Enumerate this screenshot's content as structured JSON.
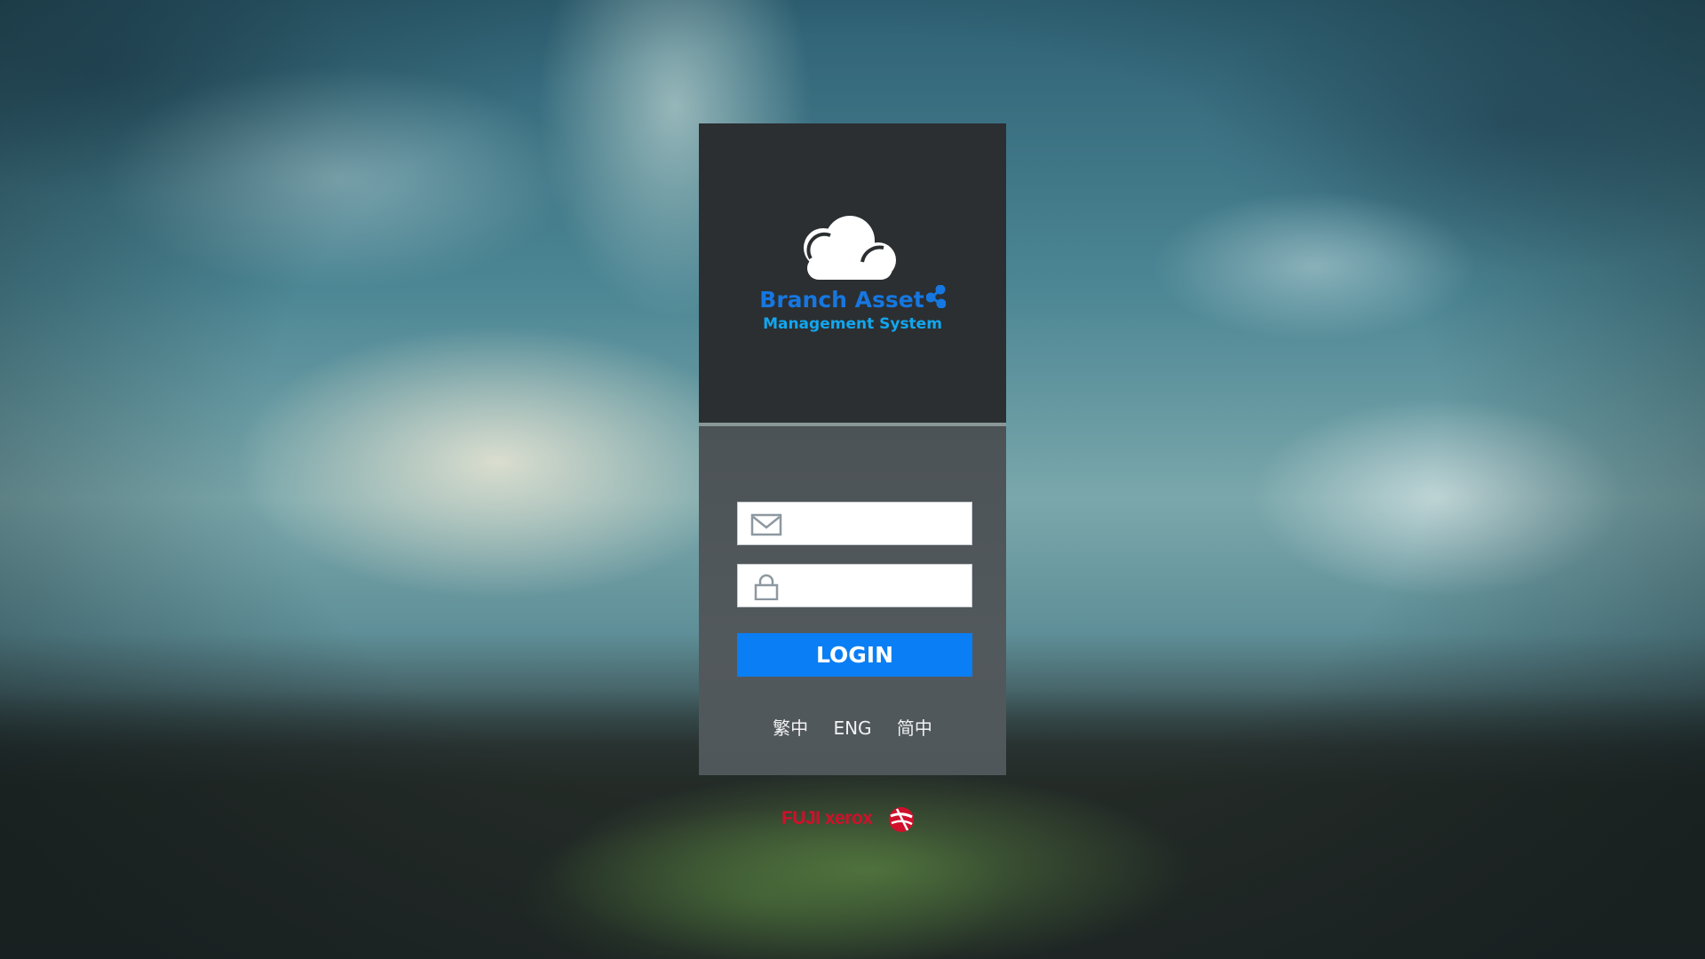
{
  "app": {
    "brand_line1": "Branch Asset",
    "brand_line2": "Management System"
  },
  "login_form": {
    "email_value": "",
    "password_value": "",
    "login_label": "LOGIN"
  },
  "languages": [
    "繁中",
    "ENG",
    "简中"
  ],
  "footer": {
    "company_logo_text": "FUJI xerox"
  },
  "icons": {
    "logo": "cloud-icon",
    "brand_mark": "share-icon",
    "email": "mail-icon",
    "password": "lock-icon",
    "footer_mark": "xerox-ball-icon"
  },
  "colors": {
    "accent": "#0a7ef4",
    "brand_primary": "#1677e0",
    "brand_secondary": "#12a6ee",
    "card_top": "#2b2f32",
    "card_bottom": "#50575b",
    "footer_brand": "#d0102b"
  }
}
